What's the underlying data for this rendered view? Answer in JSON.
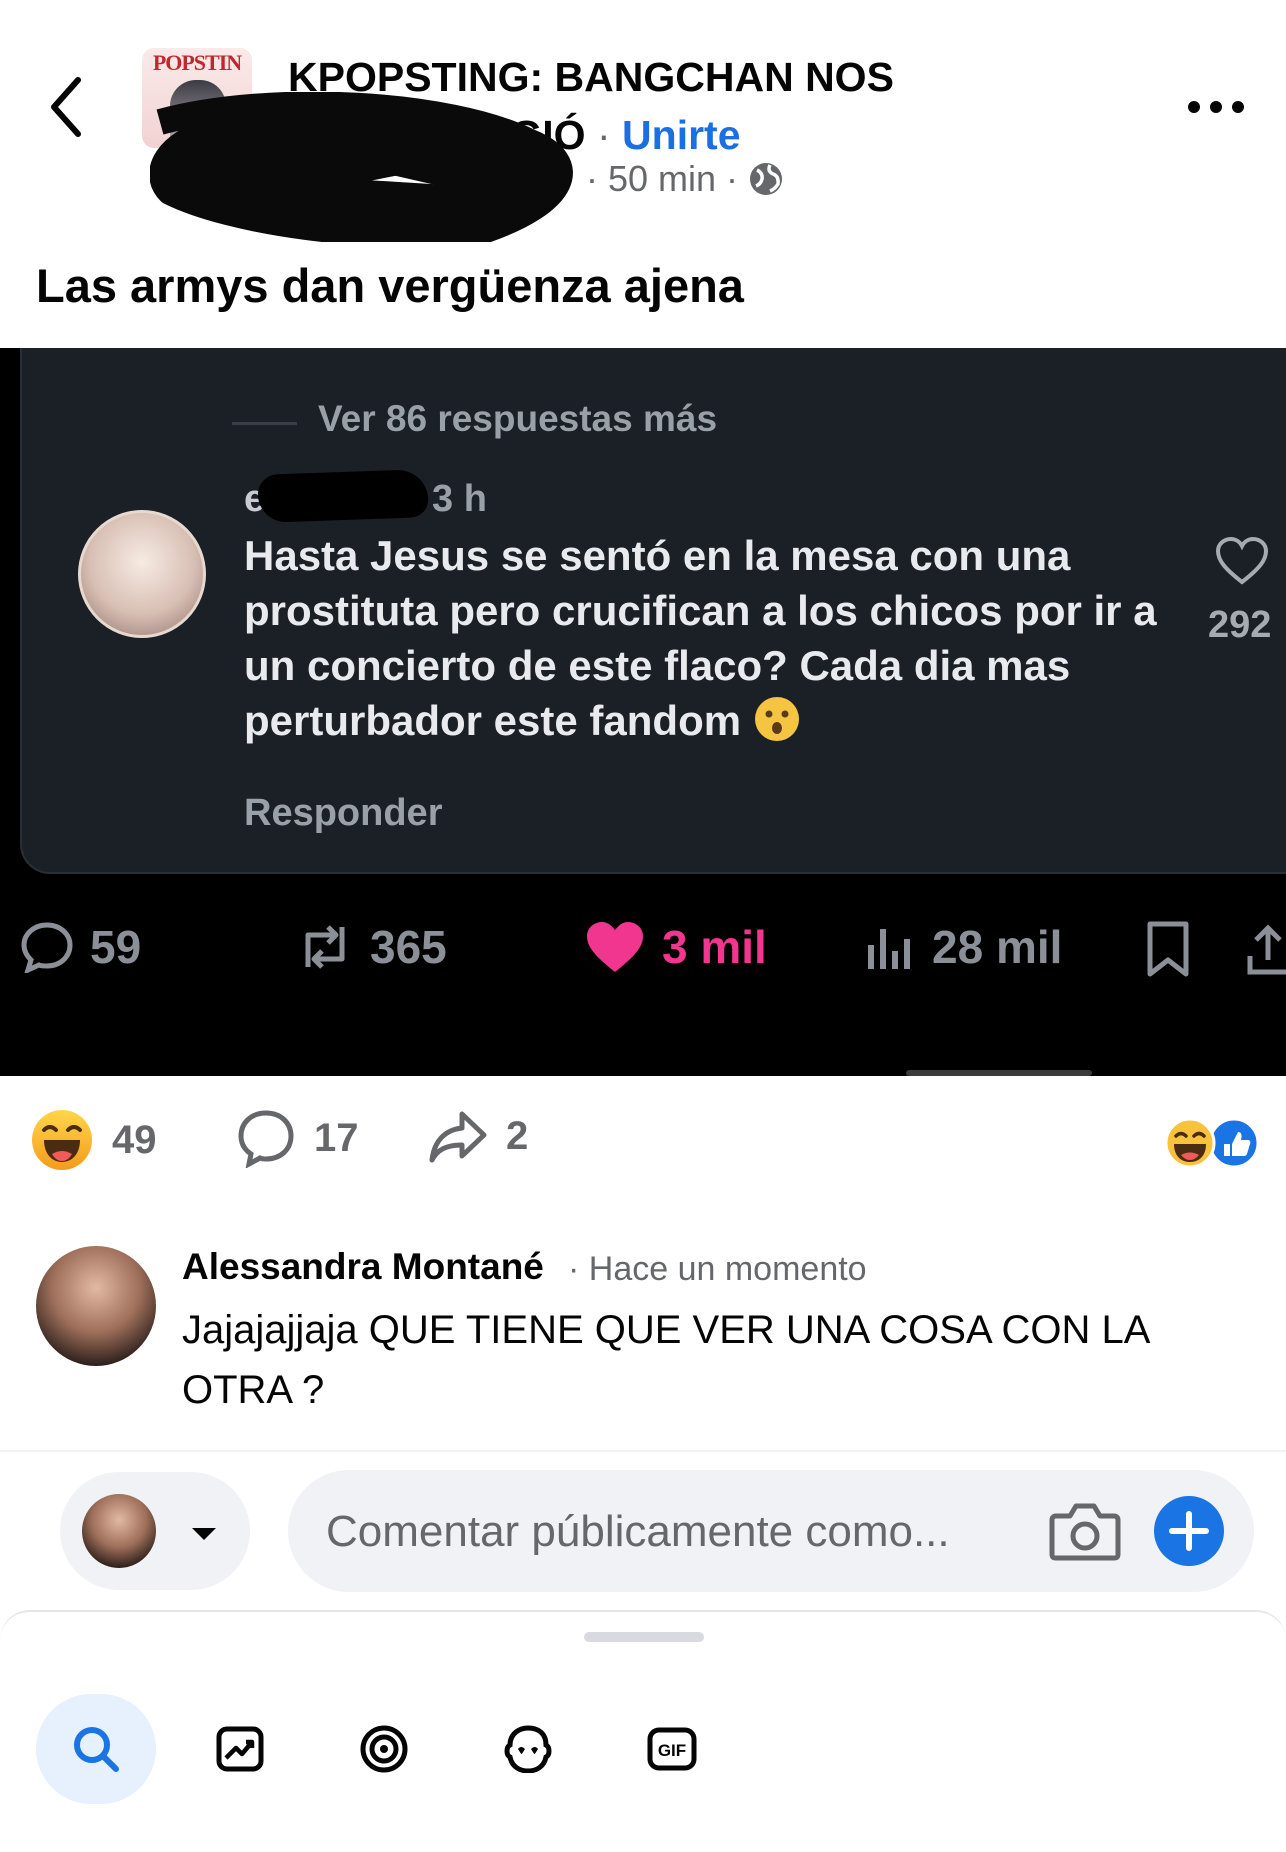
{
  "header": {
    "group_name_line1": "KPOPSTING: BANGCHAN NOS",
    "group_name_line2": "TEGIÓ",
    "separator": "·",
    "join_label": "Unirte",
    "time": "· 50 min ·",
    "avatar_text": "POPSTIN"
  },
  "post": {
    "text": "Las armys dan vergüenza ajena"
  },
  "embedded": {
    "more_replies": "Ver 86 respuestas más",
    "comment_user": "es",
    "comment_time": "3 h",
    "comment_text": "Hasta Jesus se sentó en la mesa con una prostituta pero crucifican a los chicos por ir a un concierto de este flaco? Cada dia mas perturbador este fandom",
    "reply_label": "Responder",
    "comment_likes": "292",
    "stats": {
      "replies": "59",
      "reposts": "365",
      "likes": "3 mil",
      "views": "28 mil"
    },
    "like_color": "#f0368e"
  },
  "reactions": {
    "laugh_count": "49",
    "comments_count": "17",
    "shares_count": "2"
  },
  "comment": {
    "author": "Alessandra Montané",
    "time": "· Hace un momento",
    "text": "Jajajajjaja QUE TIENE QUE VER UNA COSA CON LA OTRA ?"
  },
  "composer": {
    "placeholder": "Comentar públicamente como..."
  },
  "toolbar": {
    "icons": [
      "search-icon",
      "image-icon",
      "sticker-icon",
      "avatar-sticker-icon",
      "gif-icon"
    ],
    "gif_label": "GIF"
  },
  "colors": {
    "accent": "#1b74e4",
    "link": "#1b6fe3",
    "secondary_text": "#65676b"
  }
}
